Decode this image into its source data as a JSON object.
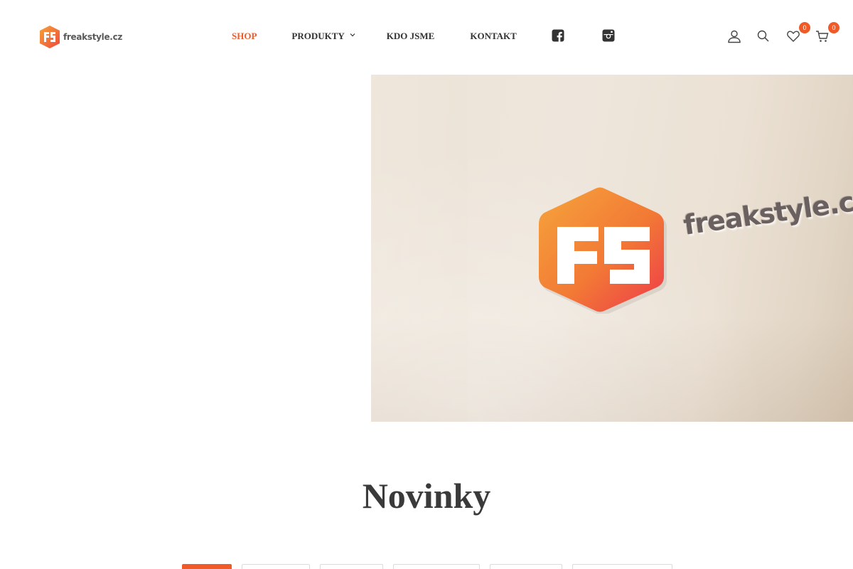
{
  "brand": {
    "logo_text": "freakstyle.cz",
    "hero_wordmark": "freakstyle.cz",
    "accent_color": "#f05a28"
  },
  "nav": {
    "items": [
      {
        "label": "SHOP",
        "active": true
      },
      {
        "label": "PRODUKTY",
        "has_dropdown": true
      },
      {
        "label": "KDO JSME"
      },
      {
        "label": "KONTAKT"
      }
    ],
    "social": [
      "facebook-icon",
      "instagram-icon"
    ]
  },
  "tools": {
    "icons": [
      "user-icon",
      "search-icon",
      "heart-icon",
      "cart-icon"
    ],
    "wishlist_count": "0",
    "cart_count": "0"
  },
  "section": {
    "title": "Novinky",
    "tab_count": 6,
    "active_tab": 0
  }
}
